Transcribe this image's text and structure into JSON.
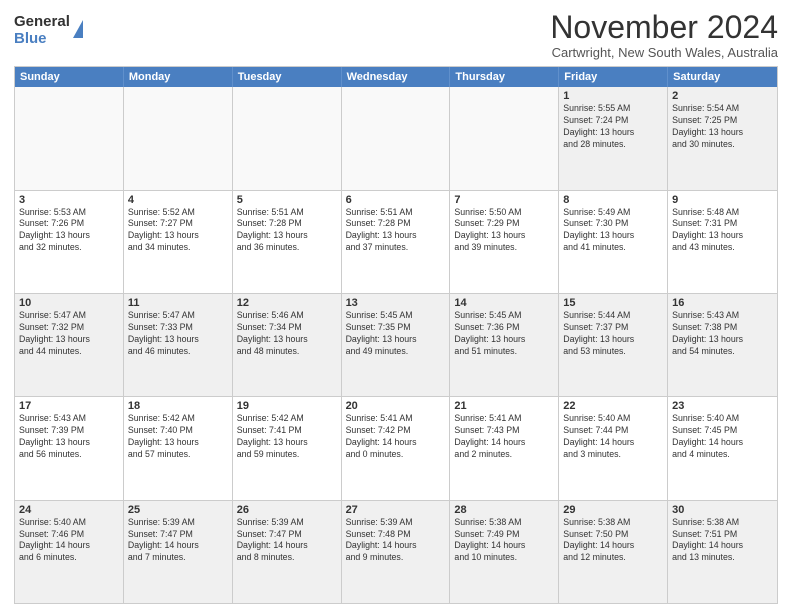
{
  "logo": {
    "general": "General",
    "blue": "Blue"
  },
  "header": {
    "month": "November 2024",
    "location": "Cartwright, New South Wales, Australia"
  },
  "days_of_week": [
    "Sunday",
    "Monday",
    "Tuesday",
    "Wednesday",
    "Thursday",
    "Friday",
    "Saturday"
  ],
  "rows": [
    [
      {
        "day": "",
        "info": ""
      },
      {
        "day": "",
        "info": ""
      },
      {
        "day": "",
        "info": ""
      },
      {
        "day": "",
        "info": ""
      },
      {
        "day": "",
        "info": ""
      },
      {
        "day": "1",
        "info": "Sunrise: 5:55 AM\nSunset: 7:24 PM\nDaylight: 13 hours\nand 28 minutes."
      },
      {
        "day": "2",
        "info": "Sunrise: 5:54 AM\nSunset: 7:25 PM\nDaylight: 13 hours\nand 30 minutes."
      }
    ],
    [
      {
        "day": "3",
        "info": "Sunrise: 5:53 AM\nSunset: 7:26 PM\nDaylight: 13 hours\nand 32 minutes."
      },
      {
        "day": "4",
        "info": "Sunrise: 5:52 AM\nSunset: 7:27 PM\nDaylight: 13 hours\nand 34 minutes."
      },
      {
        "day": "5",
        "info": "Sunrise: 5:51 AM\nSunset: 7:28 PM\nDaylight: 13 hours\nand 36 minutes."
      },
      {
        "day": "6",
        "info": "Sunrise: 5:51 AM\nSunset: 7:28 PM\nDaylight: 13 hours\nand 37 minutes."
      },
      {
        "day": "7",
        "info": "Sunrise: 5:50 AM\nSunset: 7:29 PM\nDaylight: 13 hours\nand 39 minutes."
      },
      {
        "day": "8",
        "info": "Sunrise: 5:49 AM\nSunset: 7:30 PM\nDaylight: 13 hours\nand 41 minutes."
      },
      {
        "day": "9",
        "info": "Sunrise: 5:48 AM\nSunset: 7:31 PM\nDaylight: 13 hours\nand 43 minutes."
      }
    ],
    [
      {
        "day": "10",
        "info": "Sunrise: 5:47 AM\nSunset: 7:32 PM\nDaylight: 13 hours\nand 44 minutes."
      },
      {
        "day": "11",
        "info": "Sunrise: 5:47 AM\nSunset: 7:33 PM\nDaylight: 13 hours\nand 46 minutes."
      },
      {
        "day": "12",
        "info": "Sunrise: 5:46 AM\nSunset: 7:34 PM\nDaylight: 13 hours\nand 48 minutes."
      },
      {
        "day": "13",
        "info": "Sunrise: 5:45 AM\nSunset: 7:35 PM\nDaylight: 13 hours\nand 49 minutes."
      },
      {
        "day": "14",
        "info": "Sunrise: 5:45 AM\nSunset: 7:36 PM\nDaylight: 13 hours\nand 51 minutes."
      },
      {
        "day": "15",
        "info": "Sunrise: 5:44 AM\nSunset: 7:37 PM\nDaylight: 13 hours\nand 53 minutes."
      },
      {
        "day": "16",
        "info": "Sunrise: 5:43 AM\nSunset: 7:38 PM\nDaylight: 13 hours\nand 54 minutes."
      }
    ],
    [
      {
        "day": "17",
        "info": "Sunrise: 5:43 AM\nSunset: 7:39 PM\nDaylight: 13 hours\nand 56 minutes."
      },
      {
        "day": "18",
        "info": "Sunrise: 5:42 AM\nSunset: 7:40 PM\nDaylight: 13 hours\nand 57 minutes."
      },
      {
        "day": "19",
        "info": "Sunrise: 5:42 AM\nSunset: 7:41 PM\nDaylight: 13 hours\nand 59 minutes."
      },
      {
        "day": "20",
        "info": "Sunrise: 5:41 AM\nSunset: 7:42 PM\nDaylight: 14 hours\nand 0 minutes."
      },
      {
        "day": "21",
        "info": "Sunrise: 5:41 AM\nSunset: 7:43 PM\nDaylight: 14 hours\nand 2 minutes."
      },
      {
        "day": "22",
        "info": "Sunrise: 5:40 AM\nSunset: 7:44 PM\nDaylight: 14 hours\nand 3 minutes."
      },
      {
        "day": "23",
        "info": "Sunrise: 5:40 AM\nSunset: 7:45 PM\nDaylight: 14 hours\nand 4 minutes."
      }
    ],
    [
      {
        "day": "24",
        "info": "Sunrise: 5:40 AM\nSunset: 7:46 PM\nDaylight: 14 hours\nand 6 minutes."
      },
      {
        "day": "25",
        "info": "Sunrise: 5:39 AM\nSunset: 7:47 PM\nDaylight: 14 hours\nand 7 minutes."
      },
      {
        "day": "26",
        "info": "Sunrise: 5:39 AM\nSunset: 7:47 PM\nDaylight: 14 hours\nand 8 minutes."
      },
      {
        "day": "27",
        "info": "Sunrise: 5:39 AM\nSunset: 7:48 PM\nDaylight: 14 hours\nand 9 minutes."
      },
      {
        "day": "28",
        "info": "Sunrise: 5:38 AM\nSunset: 7:49 PM\nDaylight: 14 hours\nand 10 minutes."
      },
      {
        "day": "29",
        "info": "Sunrise: 5:38 AM\nSunset: 7:50 PM\nDaylight: 14 hours\nand 12 minutes."
      },
      {
        "day": "30",
        "info": "Sunrise: 5:38 AM\nSunset: 7:51 PM\nDaylight: 14 hours\nand 13 minutes."
      }
    ]
  ]
}
